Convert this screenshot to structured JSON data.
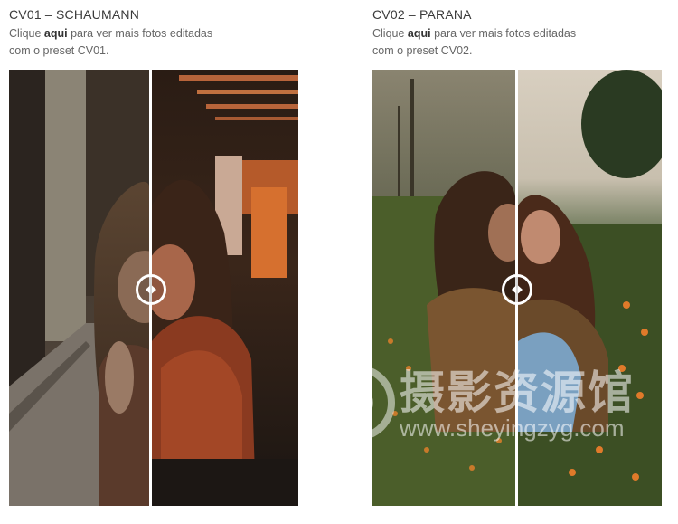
{
  "presets": [
    {
      "title": "CV01 – SCHAUMANN",
      "description_prefix": "Clique ",
      "link_text": "aqui",
      "description_suffix": " para ver mais fotos editadas com o preset CV01."
    },
    {
      "title": "CV02 – PARANA",
      "description_prefix": "Clique ",
      "link_text": "aqui",
      "description_suffix": " para ver mais fotos editadas com o preset CV02."
    }
  ],
  "slider_position": 0.48,
  "icons": {
    "handle": "left-right-arrows-icon"
  },
  "watermark": {
    "text": "摄影资源馆",
    "url": "www.sheyingzyg.com"
  },
  "colors": {
    "title": "#3a3a3a",
    "description": "#666666",
    "handle_border": "#ffffff"
  }
}
